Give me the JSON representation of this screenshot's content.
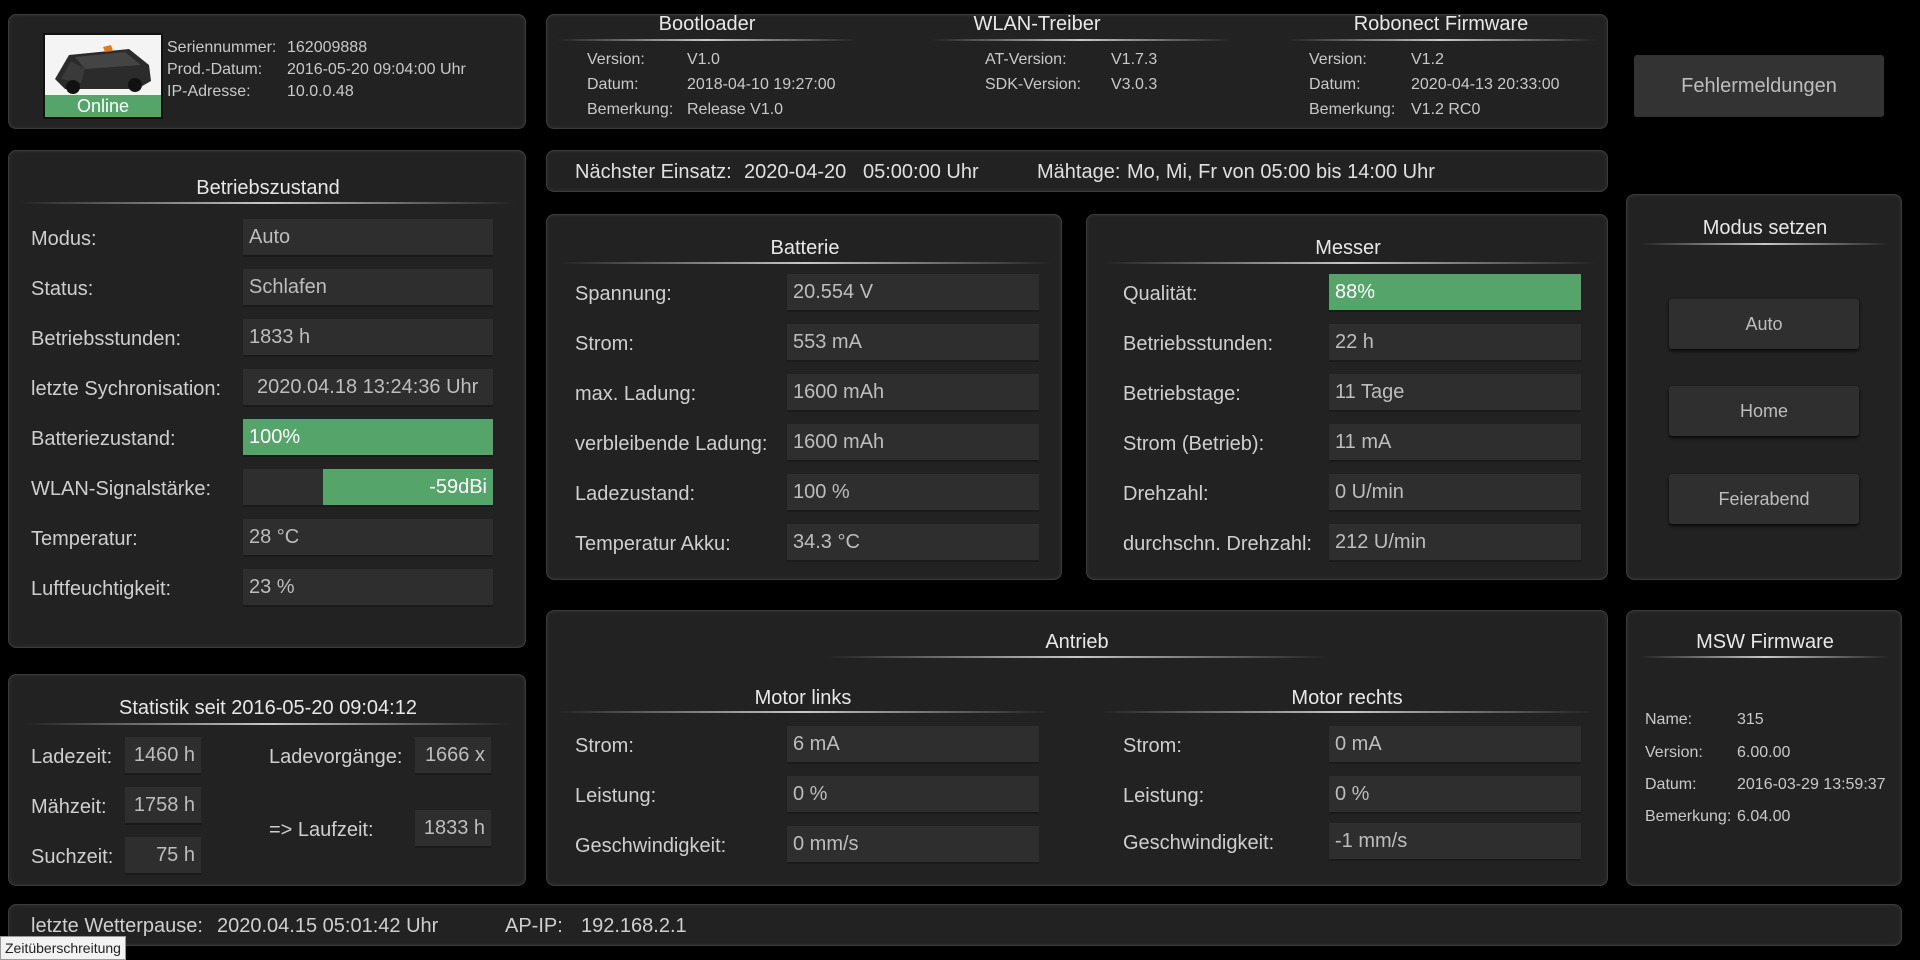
{
  "device": {
    "status": "Online",
    "serial_label": "Seriennummer:",
    "serial": "162009888",
    "prod_label": "Prod.-Datum:",
    "prod": "2016-05-20 09:04:00 Uhr",
    "ip_label": "IP-Adresse:",
    "ip": "10.0.0.48"
  },
  "firmware": {
    "bootloader": {
      "title": "Bootloader",
      "version_label": "Version:",
      "version": "V1.0",
      "date_label": "Datum:",
      "date": "2018-04-10 19:27:00",
      "note_label": "Bemerkung:",
      "note": "Release V1.0"
    },
    "wlan": {
      "title": "WLAN-Treiber",
      "at_label": "AT-Version:",
      "at": "V1.7.3",
      "sdk_label": "SDK-Version:",
      "sdk": "V3.0.3"
    },
    "robonect": {
      "title": "Robonect Firmware",
      "version_label": "Version:",
      "version": "V1.2",
      "date_label": "Datum:",
      "date": "2020-04-13 20:33:00",
      "note_label": "Bemerkung:",
      "note": "V1.2 RC0"
    }
  },
  "errors_button": "Fehlermeldungen",
  "schedule": {
    "next_label": "Nächster Einsatz:",
    "next_date": "2020-04-20",
    "next_time": "05:00:00 Uhr",
    "days_label": "Mähtage:",
    "days": "Mo, Mi, Fr von 05:00 bis 14:00 Uhr"
  },
  "betrieb": {
    "title": "Betriebszustand",
    "rows": [
      {
        "label": "Modus:",
        "value": "Auto"
      },
      {
        "label": "Status:",
        "value": "Schlafen"
      },
      {
        "label": "Betriebsstunden:",
        "value": "1833 h"
      },
      {
        "label": "letzte Sychronisation:",
        "value": "2020.04.18 13:24:36 Uhr"
      },
      {
        "label": "Batteriezustand:",
        "value": "100%"
      },
      {
        "label": "WLAN-Signalstärke:",
        "value": "-59dBi"
      },
      {
        "label": "Temperatur:",
        "value": "28 °C"
      },
      {
        "label": "Luftfeuchtigkeit:",
        "value": "23 %"
      }
    ],
    "battery_fill": 1.0,
    "wlan_fill": 0.68
  },
  "batterie": {
    "title": "Batterie",
    "rows": [
      {
        "label": "Spannung:",
        "value": "20.554 V"
      },
      {
        "label": "Strom:",
        "value": "553 mA"
      },
      {
        "label": "max. Ladung:",
        "value": "1600 mAh"
      },
      {
        "label": "verbleibende Ladung:",
        "value": "1600 mAh"
      },
      {
        "label": "Ladezustand:",
        "value": "100 %"
      },
      {
        "label": "Temperatur Akku:",
        "value": "34.3 °C"
      }
    ]
  },
  "messer": {
    "title": "Messer",
    "rows": [
      {
        "label": "Qualität:",
        "value": "88%"
      },
      {
        "label": "Betriebsstunden:",
        "value": "22 h"
      },
      {
        "label": "Betriebstage:",
        "value": "11 Tage"
      },
      {
        "label": "Strom (Betrieb):",
        "value": "11 mA"
      },
      {
        "label": "Drehzahl:",
        "value": "0 U/min"
      },
      {
        "label": "durchschn. Drehzahl:",
        "value": "212 U/min"
      }
    ],
    "quality_fill": 1.0
  },
  "modus": {
    "title": "Modus setzen",
    "buttons": [
      "Auto",
      "Home",
      "Feierabend"
    ]
  },
  "statistik": {
    "title": "Statistik seit 2016-05-20 09:04:12",
    "ladezeit_label": "Ladezeit:",
    "ladezeit": "1460 h",
    "maehzeit_label": "Mähzeit:",
    "maehzeit": "1758 h",
    "suchzeit_label": "Suchzeit:",
    "suchzeit": "75 h",
    "ladevorgaenge_label": "Ladevorgänge:",
    "ladevorgaenge": "1666 x",
    "laufzeit_label": "=> Laufzeit:",
    "laufzeit": "1833 h"
  },
  "antrieb": {
    "title": "Antrieb",
    "left": {
      "title": "Motor links",
      "rows": [
        {
          "label": "Strom:",
          "value": "6 mA"
        },
        {
          "label": "Leistung:",
          "value": "0 %"
        },
        {
          "label": "Geschwindigkeit:",
          "value": "0 mm/s"
        }
      ]
    },
    "right": {
      "title": "Motor rechts",
      "rows": [
        {
          "label": "Strom:",
          "value": "0 mA"
        },
        {
          "label": "Leistung:",
          "value": "0 %"
        },
        {
          "label": "Geschwindigkeit:",
          "value": "-1 mm/s"
        }
      ]
    }
  },
  "msw": {
    "title": "MSW Firmware",
    "name_label": "Name:",
    "name": "315",
    "version_label": "Version:",
    "version": "6.00.00",
    "date_label": "Datum:",
    "date": "2016-03-29 13:59:37",
    "note_label": "Bemerkung:",
    "note": "6.04.00"
  },
  "footer": {
    "wetter_label": "letzte Wetterpause:",
    "wetter": "2020.04.15 05:01:42 Uhr",
    "ap_label": "AP-IP:",
    "ap": "192.168.2.1"
  },
  "timeout_tag": "Zeitüberschreitung",
  "colors": {
    "accent_green": "#55a56a",
    "panel": "#222222",
    "value_box": "#2e2e2e"
  }
}
